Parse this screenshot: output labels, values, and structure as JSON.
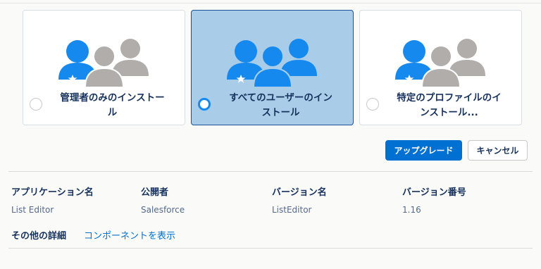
{
  "install_options": [
    {
      "label_line1": "管理者のみのインストー",
      "label_line2": "ル",
      "selected": false
    },
    {
      "label_line1": "すべてのユーザーのイン",
      "label_line2": "ストール",
      "selected": true
    },
    {
      "label_line1": "特定のプロファイルのイ",
      "label_line2": "ンストール...",
      "selected": false
    }
  ],
  "buttons": {
    "upgrade": "アップグレード",
    "cancel": "キャンセル"
  },
  "details": {
    "headers": [
      "アプリケーション名",
      "公開者",
      "バージョン名",
      "バージョン番号"
    ],
    "values": [
      "List Editor",
      "Salesforce",
      "ListEditor",
      "1.16"
    ],
    "more_label": "その他の詳細",
    "more_link": "コンポーネントを表示"
  },
  "colors": {
    "accent_blue": "#1589ee",
    "user_gray": "#b0adab",
    "selected_card": "#a9cde9",
    "primary_button": "#0070d2",
    "heading_text": "#16325c"
  },
  "icons": [
    "users-admin-icon",
    "users-all-icon",
    "users-profile-icon",
    "star-icon"
  ]
}
